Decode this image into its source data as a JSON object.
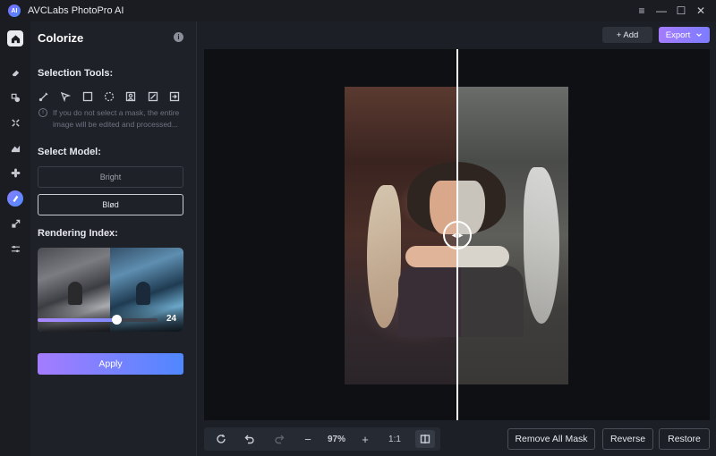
{
  "window": {
    "title": "AVCLabs PhotoPro AI",
    "logo_text": "AI",
    "controls": [
      "≡",
      "—",
      "☐",
      "✕"
    ]
  },
  "rail": {
    "items": [
      "home-icon",
      "eraser-icon",
      "retouch-icon",
      "enhance-icon",
      "background-icon",
      "fan-icon",
      "colorize-icon",
      "upscale-icon",
      "adjust-icon"
    ]
  },
  "panel": {
    "title": "Colorize",
    "info_icon": "i",
    "selection_tools_label": "Selection Tools:",
    "selection_hint_icon": "i",
    "selection_hint": "If you do not select a mask, the entire image will be edited and processed...",
    "select_model_label": "Select Model:",
    "models": [
      {
        "label": "Bright",
        "selected": false
      },
      {
        "label": "Blød",
        "selected": true
      }
    ],
    "rendering_index_label": "Rendering Index:",
    "rendering_index_value": "24",
    "rendering_index_level": 0.66,
    "apply_label": "Apply"
  },
  "topbar": {
    "add_label": "+ Add",
    "export_label": "Export"
  },
  "canvas": {
    "compare_handle": "◂ ▸"
  },
  "bottom": {
    "zoom": "97%",
    "minus": "−",
    "plus": "+",
    "ratio": "1:1"
  },
  "actions": {
    "remove_all_mask": "Remove All Mask",
    "reverse": "Reverse",
    "restore": "Restore"
  },
  "colors": {
    "accent_start": "#a57cff",
    "accent_end": "#4f87ff",
    "background": "#1c1f26"
  }
}
